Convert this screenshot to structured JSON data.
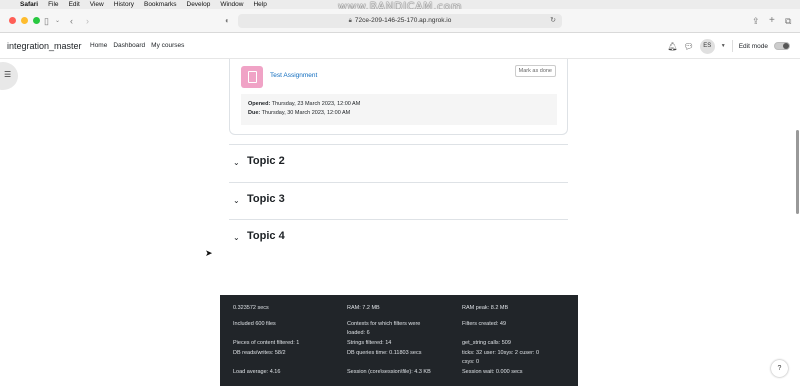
{
  "macos_menu": {
    "apple": "",
    "app": "Safari",
    "items": [
      "File",
      "Edit",
      "View",
      "History",
      "Bookmarks",
      "Develop",
      "Window",
      "Help"
    ]
  },
  "watermark": "www.BANDICAM.com",
  "browser": {
    "url": "72ce-209-146-25-170.ap.ngrok.io"
  },
  "navbar": {
    "brand": "integration_master",
    "links": [
      "Home",
      "Dashboard",
      "My courses"
    ],
    "avatar_initials": "ES",
    "edit_mode_label": "Edit mode"
  },
  "activity": {
    "name": "Test Assignment",
    "mark_done_label": "Mark as done",
    "opened_label": "Opened:",
    "opened_value": "Thursday, 23 March 2023, 12:00 AM",
    "due_label": "Due:",
    "due_value": "Thursday, 30 March 2023, 12:00 AM"
  },
  "topics": [
    "Topic 2",
    "Topic 3",
    "Topic 4"
  ],
  "perf": {
    "secs": "0.323572 secs",
    "ram": "RAM: 7.2 MB",
    "ram_peak": "RAM peak: 8.2 MB",
    "included": "Included 600 files",
    "contexts_1": "Contexts for which filters were",
    "contexts_2": "loaded: 6",
    "filters_created": "Filters created: 49",
    "pieces": "Pieces of content filtered: 1",
    "strings": "Strings filtered: 14",
    "get_string": "get_string calls: 509",
    "db_rw": "DB reads/writes: 58/2",
    "db_time": "DB queries time: 0.11803 secs",
    "ticks": "ticks: 32 user: 10sys: 2 cuser: 0",
    "csys": "csys: 0",
    "load": "Load average: 4.16",
    "session": "Session (core\\session\\file): 4.3 KB",
    "session_wait": "Session wait: 0.000 secs"
  },
  "help_label": "?",
  "colors": {
    "brand_link": "#0f6cbf",
    "assignment_icon": "#f0a3c6",
    "footer_bg": "#212529",
    "traffic_red": "#ff5f57",
    "traffic_yellow": "#febc2e",
    "traffic_green": "#28c840"
  }
}
